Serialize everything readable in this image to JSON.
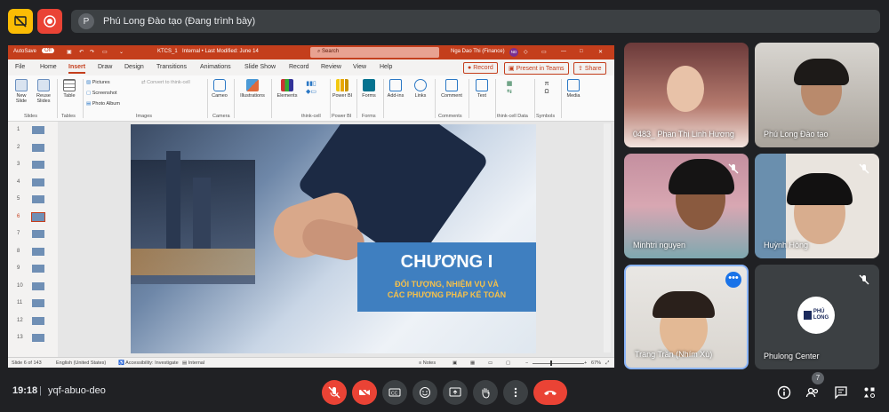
{
  "meet": {
    "presenter_initial": "P",
    "presenting_label": "Phú Long Đào tạo (Đang trình bày)",
    "time": "19:18",
    "meeting_code": "yqf-abuo-deo",
    "people_count": "7"
  },
  "ppt": {
    "autosave": "AutoSave",
    "autosave_state": "Off",
    "file_name": "KTCS_1",
    "file_meta": "Internal • Last Modified: June 14",
    "search_placeholder": "Search",
    "user_name": "Nga Dao Thi (Finance)",
    "user_initials": "ND",
    "tabs": [
      "File",
      "Home",
      "Insert",
      "Draw",
      "Design",
      "Transitions",
      "Animations",
      "Slide Show",
      "Record",
      "Review",
      "View",
      "Help"
    ],
    "record_btn": "Record",
    "present_teams_btn": "Present in Teams",
    "share_btn": "Share",
    "ribbon": {
      "new_slide": "New Slide",
      "reuse_slides": "Reuse Slides",
      "table": "Table",
      "pictures": "Pictures",
      "screenshot": "Screenshot",
      "photo_album": "Photo Album",
      "convert": "Convert to think-cell",
      "cameo": "Cameo",
      "illustrations": "Illustrations",
      "elements": "Elements",
      "power_bi": "Power BI",
      "forms": "Forms",
      "addins": "Add-ins",
      "links": "Links",
      "comment": "Comment",
      "text": "Text",
      "media": "Media"
    },
    "groups": {
      "slides": "Slides",
      "tables": "Tables",
      "images": "Images",
      "camera": "Camera",
      "thinkcell": "think-cell",
      "powerbi": "Power BI",
      "forms": "Forms",
      "comments": "Comments",
      "thinkcell_data": "think-cell Data",
      "symbols": "Symbols"
    },
    "thumbnails": [
      "1",
      "2",
      "3",
      "4",
      "5",
      "6",
      "7",
      "8",
      "9",
      "10",
      "11",
      "12",
      "13"
    ],
    "slide": {
      "title": "CHƯƠNG I",
      "subtitle_line1": "ĐỐI TƯỢNG, NHIỆM VỤ VÀ",
      "subtitle_line2": "CÁC PHƯƠNG PHÁP KẾ TOÁN"
    },
    "status": {
      "slide_of": "Slide 6 of 143",
      "language": "English (United States)",
      "accessibility": "Accessibility: Investigate",
      "internal": "Internal",
      "notes": "Notes",
      "zoom": "67%"
    }
  },
  "participants": [
    {
      "name": "0483_ Phan Thị Linh Hương",
      "muted": false
    },
    {
      "name": "Phú Long Đào tạo",
      "muted": false
    },
    {
      "name": "Minhtri nguyen",
      "muted": true
    },
    {
      "name": "Huỳnh Hồng",
      "muted": true
    },
    {
      "name": "Trang Trần (Nhím Xù)",
      "muted": false
    },
    {
      "name": "Phulong Center",
      "muted": true
    }
  ],
  "logo_text": [
    "PHÚ",
    "LONG"
  ],
  "colors": {
    "ppt_accent": "#c43e1c",
    "slide_banner": "#3f7fc0",
    "hangup": "#ea4335",
    "muted_btn": "#ea4335",
    "active_tile_border": "#8ab4f8"
  }
}
